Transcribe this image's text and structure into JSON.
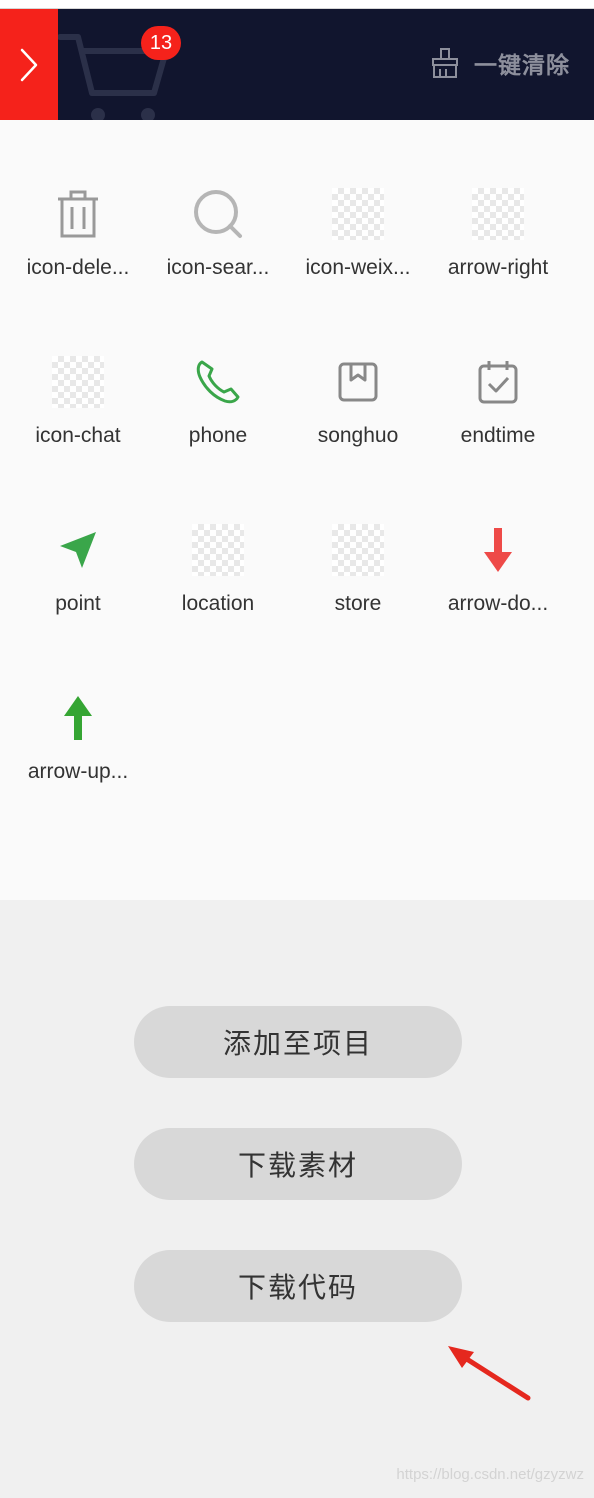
{
  "header": {
    "badge_count": "13",
    "clear_label": "一键清除",
    "colors": {
      "bar": "#11152e",
      "accent": "#f5221b"
    }
  },
  "icons": [
    {
      "label": "icon-dele...",
      "icon": "trash-icon"
    },
    {
      "label": "icon-sear...",
      "icon": "search-icon"
    },
    {
      "label": "icon-weix...",
      "icon": "placeholder-icon"
    },
    {
      "label": "arrow-right",
      "icon": "placeholder-icon"
    },
    {
      "label": "icon-chat",
      "icon": "placeholder-icon"
    },
    {
      "label": "phone",
      "icon": "phone-icon"
    },
    {
      "label": "songhuo",
      "icon": "box-icon"
    },
    {
      "label": "endtime",
      "icon": "calendar-check-icon"
    },
    {
      "label": "point",
      "icon": "navigation-arrow-icon"
    },
    {
      "label": "location",
      "icon": "placeholder-icon"
    },
    {
      "label": "store",
      "icon": "placeholder-icon"
    },
    {
      "label": "arrow-do...",
      "icon": "arrow-down-icon"
    },
    {
      "label": "arrow-up...",
      "icon": "arrow-up-icon"
    }
  ],
  "actions": {
    "add_to_project": "添加至项目",
    "download_assets": "下载素材",
    "download_code": "下载代码"
  },
  "watermark": "https://blog.csdn.net/gzyzwz"
}
